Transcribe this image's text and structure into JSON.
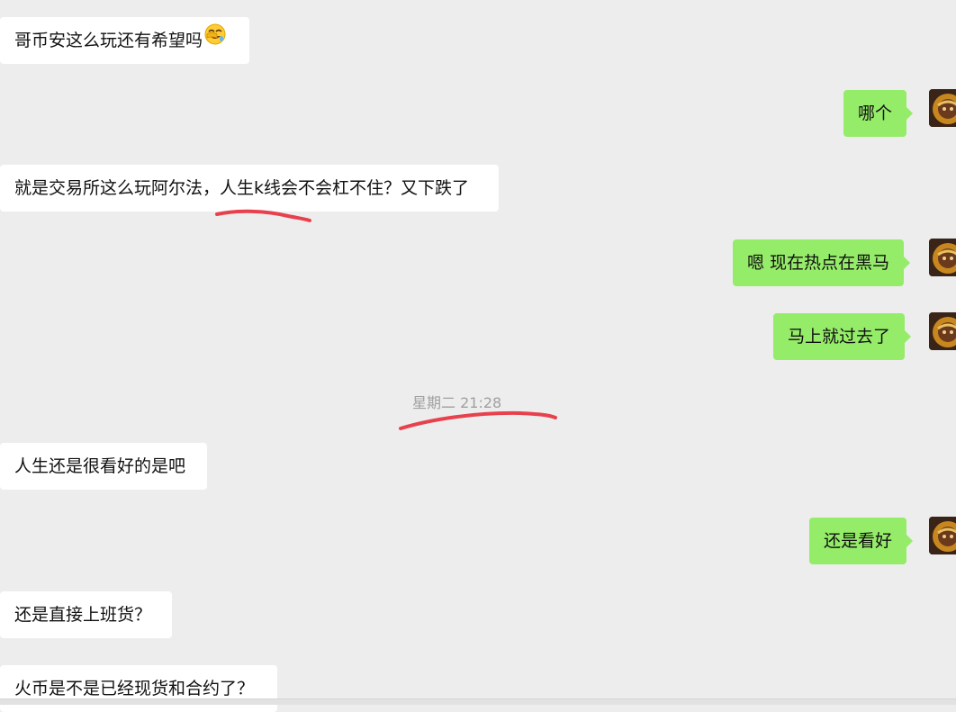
{
  "chat": {
    "messages": [
      {
        "side": "in",
        "text": "哥币安这么玩还有希望吗",
        "emoji": "facepalm-laughing-emoji"
      },
      {
        "side": "out",
        "text": "哪个"
      },
      {
        "side": "in",
        "text": "就是交易所这么玩阿尔法，人生k线会不会杠不住？又下跌了"
      },
      {
        "side": "out",
        "text": "嗯 现在热点在黑马"
      },
      {
        "side": "out",
        "text": "马上就过去了"
      },
      {
        "side": "in",
        "text": "人生还是很看好的是吧"
      },
      {
        "side": "out",
        "text": "还是看好"
      },
      {
        "side": "in",
        "text": "还是直接上班货？"
      },
      {
        "side": "in",
        "text": "火币是不是已经现货和合约了？"
      }
    ],
    "timestamp": "星期二 21:28"
  },
  "colors": {
    "background": "#ededed",
    "incoming_bubble": "#ffffff",
    "outgoing_bubble": "#95ec69",
    "annotation_stroke": "#e8414e",
    "timestamp_text": "#a0a0a0"
  },
  "icons": {
    "avatar": "user-avatar-icon",
    "emoji": "facepalm-laughing-emoji"
  }
}
